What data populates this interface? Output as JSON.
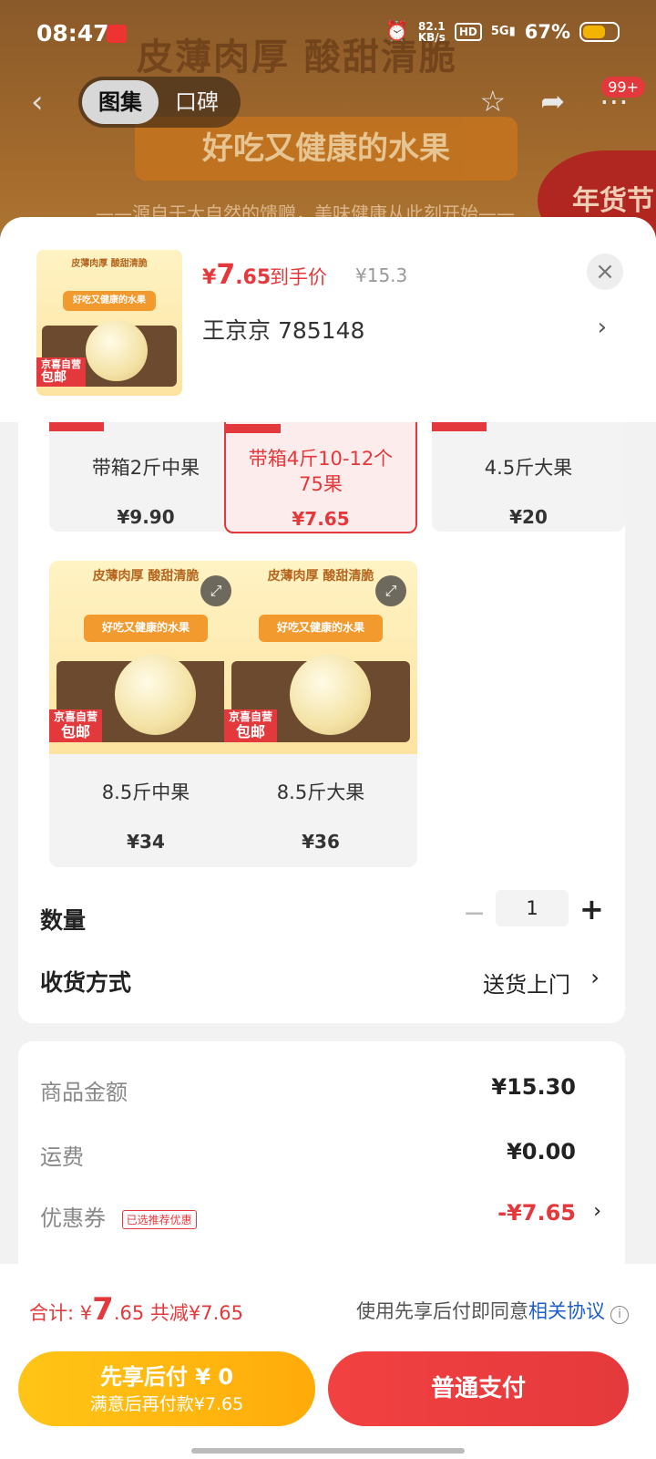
{
  "status_bar": {
    "time": "08:47",
    "net_speed_value": "82.1",
    "net_speed_unit": "KB/s",
    "hd": "HD",
    "signal": "5G",
    "battery": "67%"
  },
  "background": {
    "headline": "皮薄肉厚 酸甜清脆",
    "banner": "好吃又健康的水果",
    "slogan": "——源自于大自然的馈赠，美味健康从此刻开始——",
    "badge": "年货节"
  },
  "nav": {
    "tabs": [
      {
        "label": "图集"
      },
      {
        "label": "口碑"
      }
    ],
    "notification_count": "99+"
  },
  "product": {
    "price_symbol": "¥",
    "price_int": "7",
    "price_dec": ".65",
    "price_label": "到手价",
    "original_price": "¥15.3",
    "address": "王京京  785148",
    "image_title": "皮薄肉厚 酸甜清脆",
    "image_ribbon": "好吃又健康的水果",
    "image_tag_line1": "京喜自营",
    "image_tag_line2": "包邮"
  },
  "variants": [
    {
      "name": "带箱2斤中果",
      "price": "¥9.90",
      "selected": false
    },
    {
      "name": "带箱4斤10-12个75果",
      "price": "¥7.65",
      "selected": true
    },
    {
      "name": "4.5斤大果",
      "price": "¥20",
      "selected": false
    },
    {
      "name": "8.5斤中果",
      "price": "¥34",
      "selected": false
    },
    {
      "name": "8.5斤大果",
      "price": "¥36",
      "selected": false
    }
  ],
  "variant_image": {
    "title": "皮薄肉厚 酸甜清脆",
    "ribbon": "好吃又健康的水果",
    "tag_line1": "京喜自营",
    "tag_line2": "包邮"
  },
  "quantity": {
    "label": "数量",
    "value": "1",
    "minus": "−",
    "plus": "+"
  },
  "shipping": {
    "label": "收货方式",
    "value": "送货上门"
  },
  "fees": [
    {
      "label": "商品金额",
      "value": "¥15.30"
    },
    {
      "label": "运费",
      "value": "¥0.00"
    },
    {
      "label": "优惠券",
      "tag": "已选推荐优惠",
      "value": "-¥7.65"
    }
  ],
  "footer": {
    "total_label": "合计: ",
    "total_symbol": "¥",
    "total_int": "7",
    "total_dec": ".65",
    "total_discount": "共减¥7.65",
    "agree_text": "使用先享后付即同意",
    "agree_link": "相关协议",
    "later_line1": "先享后付 ¥ 0",
    "later_line2": "满意后再付款¥7.65",
    "pay_label": "普通支付"
  },
  "colors": {
    "accent": "#e4393c",
    "pay_later": "#ffb810",
    "link": "#1e5ecb"
  }
}
